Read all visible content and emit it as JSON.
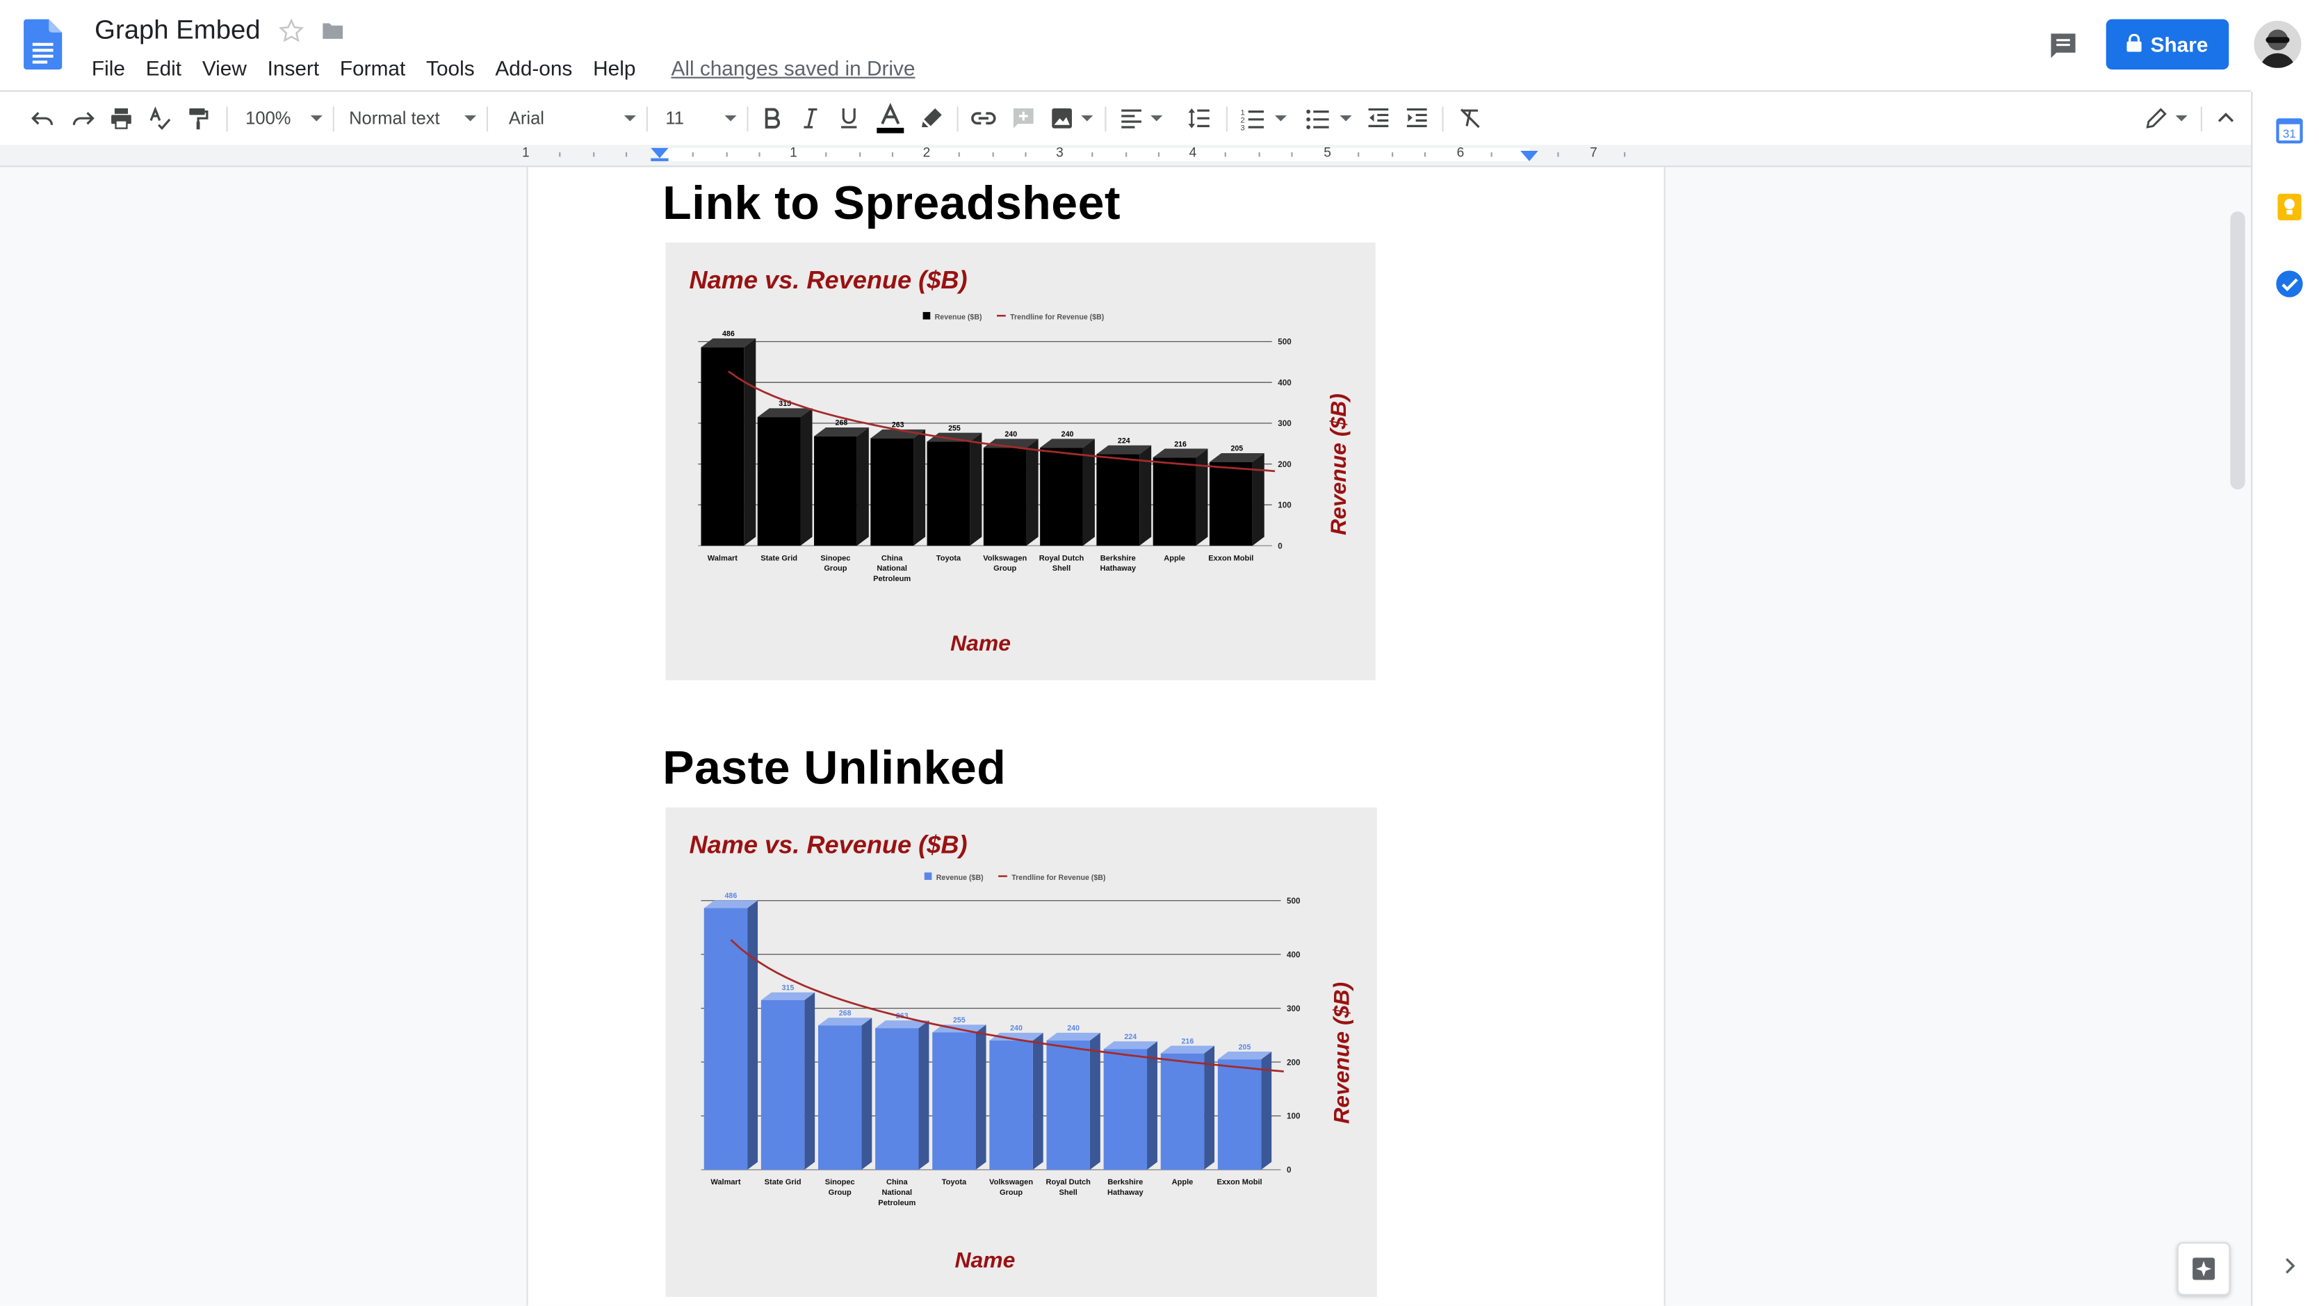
{
  "app": {
    "doc_title": "Graph Embed",
    "menu": [
      "File",
      "Edit",
      "View",
      "Insert",
      "Format",
      "Tools",
      "Add-ons",
      "Help"
    ],
    "saved_status": "All changes saved in Drive",
    "share_label": "Share"
  },
  "toolbar": {
    "zoom": "100%",
    "style": "Normal text",
    "font": "Arial",
    "font_size": "11"
  },
  "ruler": {
    "numbers": [
      "1",
      "1",
      "2",
      "3",
      "4",
      "5",
      "6",
      "7"
    ]
  },
  "document": {
    "heading1": "Link to Spreadsheet",
    "heading2": "Paste Unlinked"
  },
  "colors": {
    "accent": "#1a73e8",
    "chart1_bar": "#000000",
    "chart2_bar": "#5b86e5",
    "title_red": "#9a1111",
    "trendline": "#a52a2a",
    "chart_bg": "#ececec"
  },
  "icons": {
    "header": [
      "docs-logo-icon",
      "star-icon",
      "folder-icon",
      "comments-icon",
      "lock-icon",
      "avatar"
    ],
    "toolbar": [
      "undo-icon",
      "redo-icon",
      "print-icon",
      "spellcheck-icon",
      "paint-format-icon",
      "bold-icon",
      "italic-icon",
      "underline-icon",
      "text-color-icon",
      "highlight-icon",
      "link-icon",
      "comment-add-icon",
      "image-icon",
      "align-icon",
      "line-spacing-icon",
      "numbered-list-icon",
      "bulleted-list-icon",
      "decrease-indent-icon",
      "increase-indent-icon",
      "clear-formatting-icon",
      "pencil-edit-icon",
      "collapse-icon"
    ],
    "sidepanel": [
      "calendar-icon",
      "keep-icon",
      "tasks-icon",
      "explore-icon",
      "expand-icon"
    ]
  },
  "chart_data": [
    {
      "type": "bar",
      "title": "Name vs. Revenue ($B)",
      "xlabel": "Name",
      "ylabel": "Revenue ($B)",
      "legend": [
        "Revenue ($B)",
        "Trendline for Revenue ($B)"
      ],
      "legend_position": "top",
      "categories": [
        [
          "Walmart"
        ],
        [
          "State Grid"
        ],
        [
          "Sinopec",
          "Group"
        ],
        [
          "China",
          "National",
          "Petroleum"
        ],
        [
          "Toyota"
        ],
        [
          "Volkswagen",
          "Group"
        ],
        [
          "Royal Dutch",
          "Shell"
        ],
        [
          "Berkshire",
          "Hathaway"
        ],
        [
          "Apple"
        ],
        [
          "Exxon Mobil"
        ]
      ],
      "values": [
        486,
        315,
        268,
        263,
        255,
        240,
        240,
        224,
        216,
        205
      ],
      "ylim": [
        0,
        500
      ],
      "yticks": [
        0,
        100,
        200,
        300,
        400,
        500
      ],
      "y_axis_side": "right",
      "grid": true,
      "trendline": "logarithmic",
      "bar_color": "#000000"
    },
    {
      "type": "bar",
      "title": "Name vs. Revenue ($B)",
      "xlabel": "Name",
      "ylabel": "Revenue ($B)",
      "legend": [
        "Revenue ($B)",
        "Trendline for Revenue ($B)"
      ],
      "legend_position": "top",
      "categories": [
        [
          "Walmart"
        ],
        [
          "State Grid"
        ],
        [
          "Sinopec",
          "Group"
        ],
        [
          "China",
          "National",
          "Petroleum"
        ],
        [
          "Toyota"
        ],
        [
          "Volkswagen",
          "Group"
        ],
        [
          "Royal Dutch",
          "Shell"
        ],
        [
          "Berkshire",
          "Hathaway"
        ],
        [
          "Apple"
        ],
        [
          "Exxon Mobil"
        ]
      ],
      "values": [
        486,
        315,
        268,
        263,
        255,
        240,
        240,
        224,
        216,
        205
      ],
      "ylim": [
        0,
        500
      ],
      "yticks": [
        0,
        100,
        200,
        300,
        400,
        500
      ],
      "y_axis_side": "right",
      "grid": true,
      "trendline": "logarithmic",
      "bar_color": "#5b86e5"
    }
  ]
}
